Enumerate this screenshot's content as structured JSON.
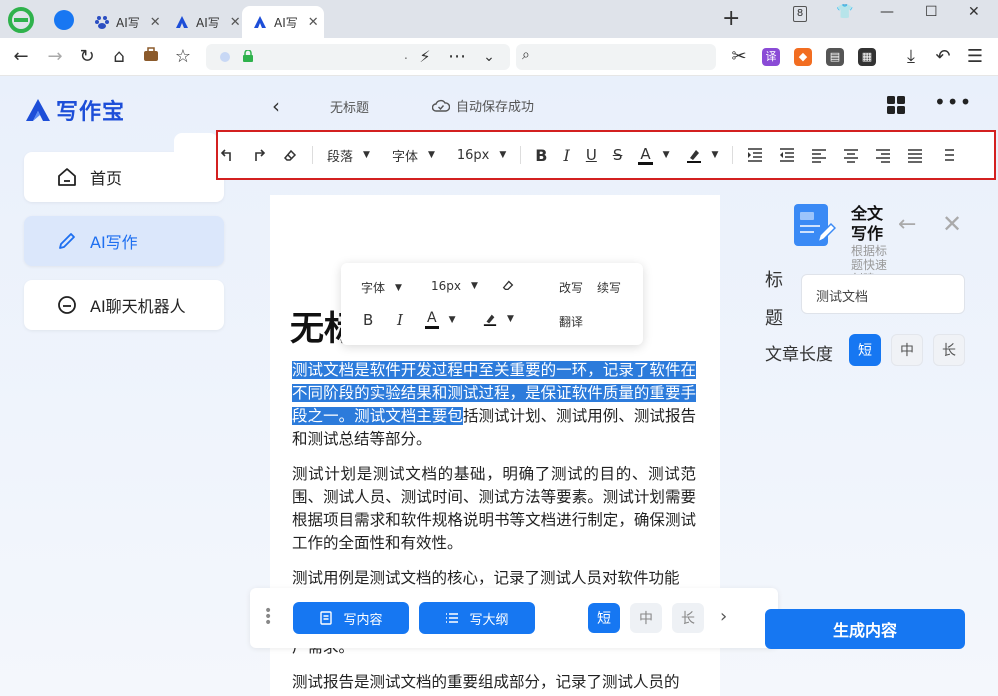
{
  "browser": {
    "tabs": [
      {
        "label": "AI写"
      },
      {
        "label": "AI写"
      },
      {
        "label": "AI写"
      }
    ],
    "new_tab": "+",
    "tab_count": "8",
    "url_text": ".",
    "accent": "#1677f2"
  },
  "app": {
    "logo_text": "写作宝",
    "sidebar": {
      "items": [
        {
          "label": "首页",
          "icon": "home-icon"
        },
        {
          "label": "AI写作",
          "icon": "pen-icon"
        },
        {
          "label": "AI聊天机器人",
          "icon": "chat-icon"
        }
      ],
      "active_index": 1
    },
    "topbar": {
      "back": "‹",
      "doc_title": "无标题",
      "save_status": "自动保存成功",
      "more": "•••"
    },
    "toolbar": {
      "paragraph": "段落",
      "font": "字体",
      "size": "16px",
      "bold": "B",
      "italic": "I",
      "underline": "U",
      "strike": "S",
      "font_color": "A"
    },
    "float_bar": {
      "font": "字体",
      "size": "16px",
      "rewrite": "改写",
      "continue": "续写",
      "translate": "翻译",
      "bold": "B",
      "italic": "I",
      "font_color": "A"
    },
    "document": {
      "heading": "无标",
      "p1_highlight": "测试文档是软件开发过程中至关重要的一环，记录了软件在不同阶段的实验结果和测试过程，是保证软件质量的重要手段之一。测试文档主要包",
      "p1_rest": "括测试计划、测试用例、测试报告和测试总结等部分。",
      "p2": "测试计划是测试文档的基础，明确了测试的目的、测试范围、测试人员、测试时间、测试方法等要素。测试计划需要根据项目需求和软件规格说明书等文档进行制定，确保测试工作的全面性和有效性。",
      "p3": "测试用例是测试文档的核心，记录了测试人员对软件功能",
      "p4": "户需求。",
      "p5": "测试报告是测试文档的重要组成部分，记录了测试人员的"
    },
    "write_bar": {
      "write_content": "写内容",
      "write_outline": "写大纲",
      "lengths": [
        "短",
        "中",
        "长"
      ],
      "next": "›"
    },
    "right_panel": {
      "title": "全文写作",
      "subtitle": "根据标题快速创建一篇文章",
      "back": "←",
      "close": "✕",
      "label_title": "标题",
      "title_input": "测试文档",
      "label_length": "文章长度",
      "lengths": [
        "短",
        "中",
        "长"
      ],
      "generate": "生成内容"
    }
  }
}
